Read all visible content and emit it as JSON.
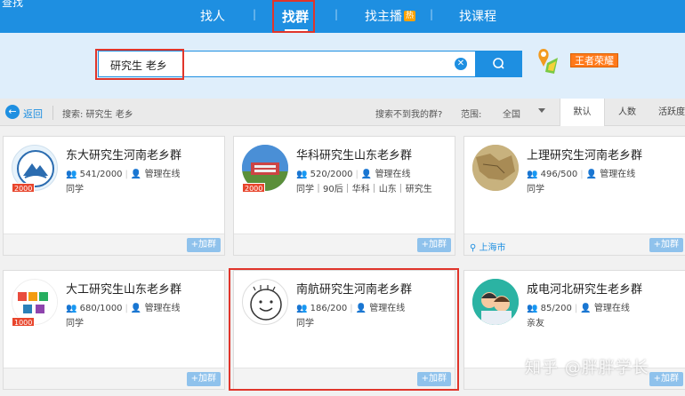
{
  "app": {
    "title": "查找"
  },
  "nav": {
    "items": [
      {
        "label": "找人"
      },
      {
        "label": "找群",
        "active": true
      },
      {
        "label": "找主播",
        "badge": "热"
      },
      {
        "label": "找课程"
      }
    ],
    "separator": "|"
  },
  "search": {
    "value": "研究生 老乡",
    "clear_icon": "clear-icon",
    "button_icon": "search-icon"
  },
  "promo": {
    "icon": "game-character-icon",
    "badge": "王者荣耀"
  },
  "filter": {
    "back_label": "返回",
    "summary": "搜索: 研究生 老乡",
    "not_found": "搜索不到我的群?",
    "range_label": "范围:",
    "range_value": "全国",
    "sort_tabs": [
      "默认",
      "人数",
      "活跃度"
    ]
  },
  "groups": [
    {
      "title": "东大研究生河南老乡群",
      "members": "541/2000",
      "admin": "管理在线",
      "tags": "同学",
      "level": "2000",
      "join": "+加群",
      "location": ""
    },
    {
      "title": "华科研究生山东老乡群",
      "members": "520/2000",
      "admin": "管理在线",
      "tags": "同学｜90后｜华科｜山东｜研究生",
      "level": "2000",
      "join": "+加群",
      "location": ""
    },
    {
      "title": "上理研究生河南老乡群",
      "members": "496/500",
      "admin": "管理在线",
      "tags": "同学",
      "level": "",
      "join": "+加群",
      "location": "上海市"
    },
    {
      "title": "大工研究生山东老乡群",
      "members": "680/1000",
      "admin": "管理在线",
      "tags": "同学",
      "level": "1000",
      "join": "+加群",
      "location": ""
    },
    {
      "title": "南航研究生河南老乡群",
      "members": "186/200",
      "admin": "管理在线",
      "tags": "同学",
      "level": "",
      "join": "+加群",
      "location": ""
    },
    {
      "title": "成电河北研究生老乡群",
      "members": "85/200",
      "admin": "管理在线",
      "tags": "亲友",
      "level": "",
      "join": "+加群",
      "location": ""
    }
  ],
  "watermark": "知乎 @胖胖学长",
  "colors": {
    "primary": "#1e8fe1",
    "highlight_box": "#e0352b",
    "search_band": "#dfeefb"
  }
}
